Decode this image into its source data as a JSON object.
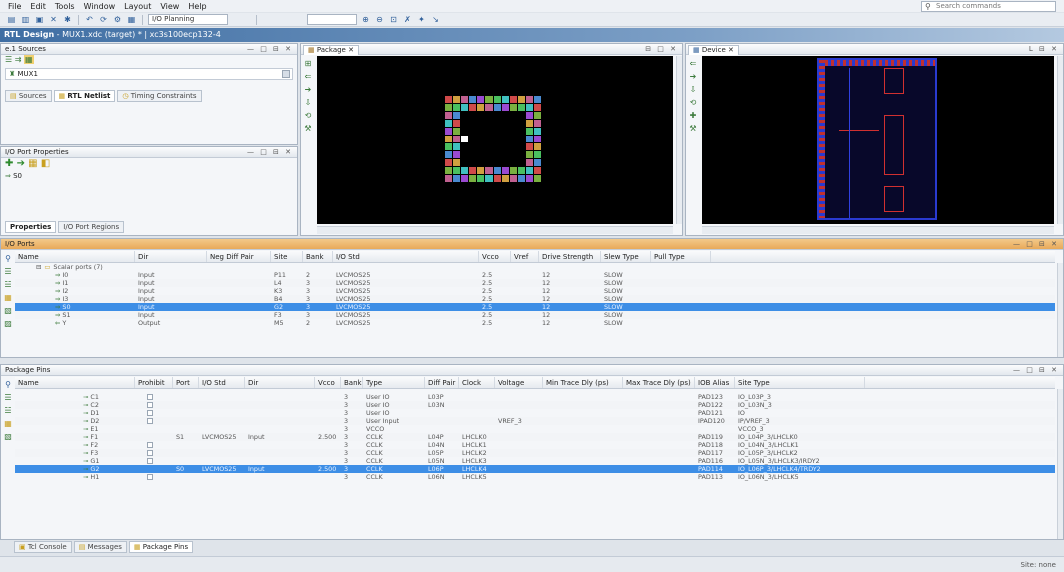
{
  "menu": [
    "File",
    "Edit",
    "Tools",
    "Window",
    "Layout",
    "View",
    "Help"
  ],
  "search": {
    "placeholder": "Search commands"
  },
  "toolbar": {
    "run_label": "I/O Planning",
    "layout_label": ""
  },
  "title": {
    "main": "RTL Design",
    "sub": " - MUX1.xdc (target) * | xc3s100ecp132-4"
  },
  "sources_panel": {
    "title": "e.1 Sources",
    "tree_item": "MUX1",
    "tabs": [
      "Sources",
      "RTL Netlist",
      "Timing Constraints"
    ]
  },
  "io_port_props": {
    "title": "I/O Port Properties",
    "item": "S0",
    "tabs": [
      "Properties",
      "I/O Port Regions"
    ]
  },
  "package_view": {
    "title": "Package"
  },
  "device_view": {
    "title": "Device"
  },
  "io_ports": {
    "title": "I/O Ports",
    "columns": [
      "Name",
      "Dir",
      "Neg Diff Pair",
      "Site",
      "Bank",
      "I/O Std",
      "Vcco",
      "Vref",
      "Drive Strength",
      "Slew Type",
      "Pull Type"
    ],
    "group": "Scalar ports (7)",
    "rows": [
      {
        "name": "I0",
        "dir": "Input",
        "site": "P11",
        "bank": "2",
        "iostd": "LVCMOS25",
        "vcco": "2.5",
        "drive": "12",
        "slew": "SLOW",
        "sel": false
      },
      {
        "name": "I1",
        "dir": "Input",
        "site": "L4",
        "bank": "3",
        "iostd": "LVCMOS25",
        "vcco": "2.5",
        "drive": "12",
        "slew": "SLOW",
        "sel": false
      },
      {
        "name": "I2",
        "dir": "Input",
        "site": "K3",
        "bank": "3",
        "iostd": "LVCMOS25",
        "vcco": "2.5",
        "drive": "12",
        "slew": "SLOW",
        "sel": false
      },
      {
        "name": "I3",
        "dir": "Input",
        "site": "B4",
        "bank": "3",
        "iostd": "LVCMOS25",
        "vcco": "2.5",
        "drive": "12",
        "slew": "SLOW",
        "sel": false
      },
      {
        "name": "S0",
        "dir": "Input",
        "site": "G2",
        "bank": "3",
        "iostd": "LVCMOS25",
        "vcco": "2.5",
        "drive": "12",
        "slew": "SLOW",
        "sel": true
      },
      {
        "name": "S1",
        "dir": "Input",
        "site": "F3",
        "bank": "3",
        "iostd": "LVCMOS25",
        "vcco": "2.5",
        "drive": "12",
        "slew": "SLOW",
        "sel": false
      },
      {
        "name": "Y",
        "dir": "Output",
        "site": "M5",
        "bank": "2",
        "iostd": "LVCMOS25",
        "vcco": "2.5",
        "drive": "12",
        "slew": "SLOW",
        "sel": false
      }
    ]
  },
  "package_pins": {
    "title": "Package Pins",
    "columns": [
      "Name",
      "Prohibit",
      "Port",
      "I/O Std",
      "Dir",
      "Vcco",
      "Bank",
      "Type",
      "Diff Pair",
      "Clock",
      "Voltage",
      "Min Trace Dly (ps)",
      "Max Trace Dly (ps)",
      "IOB Alias",
      "Site Type"
    ],
    "rows": [
      {
        "name": "C1",
        "prohibit": true,
        "port": "",
        "iostd": "",
        "dir": "",
        "vcco": "",
        "bank": "3",
        "type": "User IO",
        "diff": "L03P",
        "clock": "",
        "voltage": "",
        "alias": "PAD123",
        "site": "IO_L03P_3",
        "sel": false
      },
      {
        "name": "C2",
        "prohibit": true,
        "port": "",
        "iostd": "",
        "dir": "",
        "vcco": "",
        "bank": "3",
        "type": "User IO",
        "diff": "L03N",
        "clock": "",
        "voltage": "",
        "alias": "PAD122",
        "site": "IO_L03N_3",
        "sel": false
      },
      {
        "name": "D1",
        "prohibit": true,
        "port": "",
        "iostd": "",
        "dir": "",
        "vcco": "",
        "bank": "3",
        "type": "User IO",
        "diff": "",
        "clock": "",
        "voltage": "",
        "alias": "PAD121",
        "site": "IO",
        "sel": false
      },
      {
        "name": "D2",
        "prohibit": true,
        "port": "",
        "iostd": "",
        "dir": "",
        "vcco": "",
        "bank": "3",
        "type": "User Input",
        "diff": "",
        "clock": "",
        "voltage": "VREF_3",
        "alias": "IPAD120",
        "site": "IP/VREF_3",
        "sel": false
      },
      {
        "name": "E1",
        "prohibit": false,
        "port": "",
        "iostd": "",
        "dir": "",
        "vcco": "",
        "bank": "3",
        "type": "VCCO",
        "diff": "",
        "clock": "",
        "voltage": "",
        "alias": "",
        "site": "VCCO_3",
        "sel": false
      },
      {
        "name": "F1",
        "prohibit": false,
        "port": "S1",
        "iostd": "LVCMOS25",
        "dir": "Input",
        "vcco": "2.500",
        "bank": "3",
        "type": "CCLK",
        "diff": "L04P",
        "clock": "LHCLK0",
        "voltage": "",
        "alias": "PAD119",
        "site": "IO_L04P_3/LHCLK0",
        "sel": false
      },
      {
        "name": "F2",
        "prohibit": true,
        "port": "",
        "iostd": "",
        "dir": "",
        "vcco": "",
        "bank": "3",
        "type": "CCLK",
        "diff": "L04N",
        "clock": "LHCLK1",
        "voltage": "",
        "alias": "PAD118",
        "site": "IO_L04N_3/LHCLK1",
        "sel": false
      },
      {
        "name": "F3",
        "prohibit": true,
        "port": "",
        "iostd": "",
        "dir": "",
        "vcco": "",
        "bank": "3",
        "type": "CCLK",
        "diff": "L05P",
        "clock": "LHCLK2",
        "voltage": "",
        "alias": "PAD117",
        "site": "IO_L05P_3/LHCLK2",
        "sel": false
      },
      {
        "name": "G1",
        "prohibit": true,
        "port": "",
        "iostd": "",
        "dir": "",
        "vcco": "",
        "bank": "3",
        "type": "CCLK",
        "diff": "L05N",
        "clock": "LHCLK3",
        "voltage": "",
        "alias": "PAD116",
        "site": "IO_L05N_3/LHCLK3/IRDY2",
        "sel": false
      },
      {
        "name": "G2",
        "prohibit": false,
        "port": "S0",
        "iostd": "LVCMOS25",
        "dir": "Input",
        "vcco": "2.500",
        "bank": "3",
        "type": "CCLK",
        "diff": "L06P",
        "clock": "LHCLK4",
        "voltage": "",
        "alias": "PAD114",
        "site": "IO_L06P_3/LHCLK4/TRDY2",
        "sel": true
      },
      {
        "name": "H1",
        "prohibit": true,
        "port": "",
        "iostd": "",
        "dir": "",
        "vcco": "",
        "bank": "3",
        "type": "CCLK",
        "diff": "L06N",
        "clock": "LHCLK5",
        "voltage": "",
        "alias": "PAD113",
        "site": "IO_L06N_3/LHCLK5",
        "sel": false
      }
    ]
  },
  "bottom_tabs": [
    "Tcl Console",
    "Messages",
    "Package Pins"
  ],
  "status": {
    "text": "Site: none"
  },
  "colors": {
    "accent": "#3d8ee6",
    "title": "#3f6ea3"
  }
}
